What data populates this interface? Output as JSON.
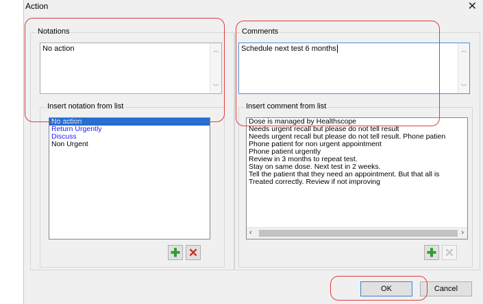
{
  "dialog": {
    "title": "Action",
    "close_glyph": "✕"
  },
  "notations": {
    "group_label": "Notations",
    "textbox_value": "No action",
    "list_group_label": "Insert notation from list",
    "items": [
      {
        "label": "No action",
        "state": "selected"
      },
      {
        "label": "Return Urgently",
        "state": "blue"
      },
      {
        "label": "Discuss",
        "state": "blue"
      },
      {
        "label": "Non Urgent",
        "state": "normal"
      }
    ],
    "add_icon": "plus-icon",
    "delete_icon": "delete-icon"
  },
  "comments": {
    "group_label": "Comments",
    "textbox_value": "Schedule next test 6 months",
    "list_group_label": "Insert comment from list",
    "items": [
      "Dose is managed by Healthscope",
      "Needs urgent recall but please do not tell result",
      "Needs urgent recall but please do not tell result. Phone patien",
      "Phone patient for non urgent appointment",
      "Phone patient urgently",
      "Review in 3 months to repeat test.",
      "Stay on same dose. Next test in 2 weeks.",
      "Tell the patient that they need an appointment.  But that all is",
      "Treated correctly. Review if not improving"
    ],
    "add_icon": "plus-icon",
    "delete_icon": "delete-icon"
  },
  "buttons": {
    "ok": "OK",
    "cancel": "Cancel"
  },
  "colors": {
    "selection": "#1e6fd9",
    "annotation": "#e03b3b",
    "accent_link": "#1a1aff"
  }
}
